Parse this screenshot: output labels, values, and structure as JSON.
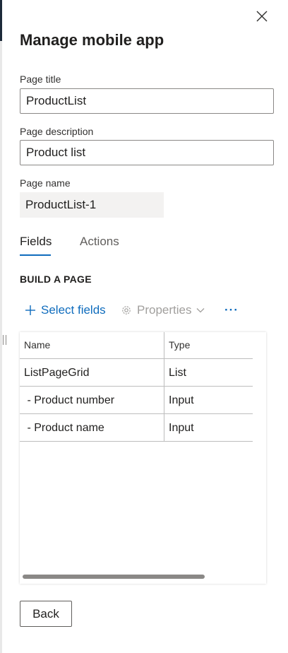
{
  "panel": {
    "title": "Manage mobile app",
    "close_icon": "close-icon"
  },
  "form": {
    "page_title": {
      "label": "Page title",
      "value": "ProductList"
    },
    "page_description": {
      "label": "Page description",
      "value": "Product list"
    },
    "page_name": {
      "label": "Page name",
      "value": "ProductList-1"
    }
  },
  "tabs": [
    {
      "label": "Fields",
      "active": true
    },
    {
      "label": "Actions",
      "active": false
    }
  ],
  "build_section": {
    "header": "BUILD A PAGE",
    "toolbar": {
      "select_fields": {
        "label": "Select fields",
        "icon": "plus-icon"
      },
      "properties": {
        "label": "Properties",
        "icon": "gear-icon",
        "chevron": "chevron-down-icon",
        "enabled": false
      },
      "more": {
        "label": "···",
        "icon": "more-icon"
      }
    }
  },
  "grid": {
    "columns": [
      "Name",
      "Type"
    ],
    "rows": [
      {
        "name": "ListPageGrid",
        "type": "List"
      },
      {
        "name": " - Product number",
        "type": "Input"
      },
      {
        "name": " - Product name",
        "type": "Input"
      }
    ]
  },
  "footer": {
    "back_label": "Back"
  },
  "colors": {
    "accent": "#0f6cbd",
    "disabled": "#a19f9d",
    "border": "#8a8886"
  }
}
